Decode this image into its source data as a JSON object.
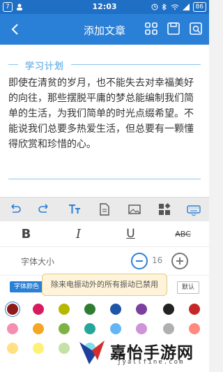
{
  "status": {
    "time": "12:03",
    "left_notif": "7",
    "battery": "86"
  },
  "app": {
    "title": "添加文章"
  },
  "editor": {
    "tag": "学习计划",
    "paragraph": "即使在清贫的岁月，也不能失去对幸福美好的向往，那些摆脱平庸的梦总能编制我们简单的生活，为我们简单的时光点缀希望。不能说我们总要多热爱生活，但总要有一颗懂得欣赏和珍惜的心。"
  },
  "format": {
    "bold": "B",
    "italic": "I",
    "underline": "U",
    "strike": "ABC"
  },
  "font_size": {
    "label": "字体大小",
    "value": "16"
  },
  "color_tabs": {
    "font_color": "字体颜色",
    "default": "默认"
  },
  "toast": {
    "text": "除来电振动外的所有振动已禁用"
  },
  "palette": {
    "row1": [
      "#8e1a1a",
      "#d81b60",
      "#b7b700",
      "#2e7d32",
      "#1e55a8",
      "#7b3fa0",
      "#222222",
      "#c62828"
    ],
    "row2": [
      "#f48fb1",
      "#f5a623",
      "#7cb342",
      "#26a69a",
      "#64b5f6",
      "#ce93d8",
      "#b0b0b0",
      "#ff8a80"
    ],
    "row3": [
      "#ffe082",
      "#fff176",
      "#c5e1a5",
      "#80deea",
      "#90caf9",
      "#e1bee7",
      "#e0e0e0",
      "#ffcdd2"
    ]
  },
  "watermark": {
    "title": "嘉怡手游网",
    "url": "jyallfine.com"
  }
}
